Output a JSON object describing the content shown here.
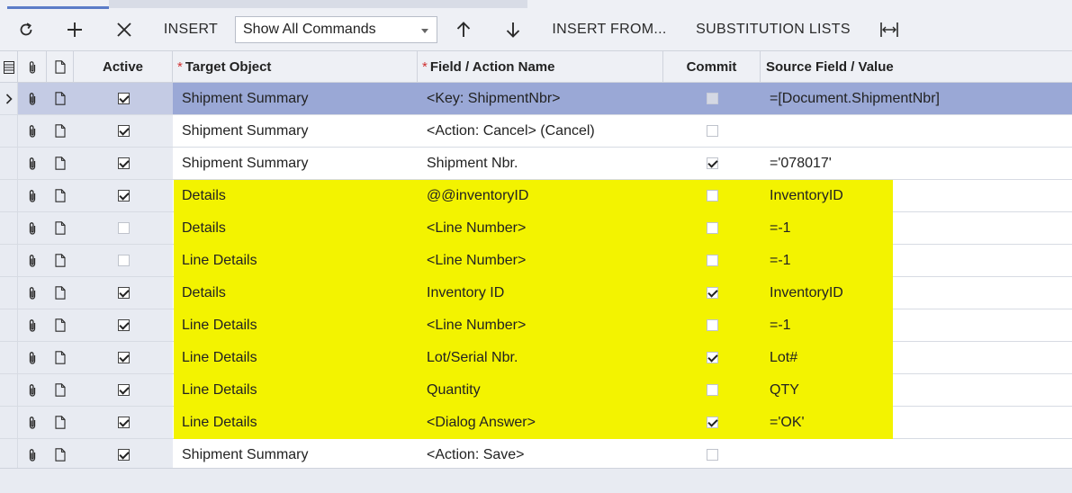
{
  "toolbar": {
    "insert_label": "INSERT",
    "command_filter": "Show All Commands",
    "insert_from_label": "INSERT FROM...",
    "substitution_lists_label": "SUBSTITUTION LISTS"
  },
  "columns": {
    "active": "Active",
    "target_object": "Target Object",
    "field_action_name": "Field / Action Name",
    "commit": "Commit",
    "source_field_value": "Source Field / Value",
    "required_marker": "*"
  },
  "colors": {
    "highlight": "#f3f300",
    "selected_row": "#9aa8d6"
  },
  "rows": [
    {
      "active": true,
      "target": "Shipment Summary",
      "field": "<Key: ShipmentNbr>",
      "commit": false,
      "source": "=[Document.ShipmentNbr]",
      "selected": true,
      "highlight": false
    },
    {
      "active": true,
      "target": "Shipment Summary",
      "field": "<Action: Cancel> (Cancel)",
      "commit": false,
      "source": "",
      "selected": false,
      "highlight": false
    },
    {
      "active": true,
      "target": "Shipment Summary",
      "field": "Shipment Nbr.",
      "commit": true,
      "source": "='078017'",
      "selected": false,
      "highlight": false
    },
    {
      "active": true,
      "target": "Details",
      "field": "@@inventoryID",
      "commit": false,
      "source": "InventoryID",
      "selected": false,
      "highlight": true
    },
    {
      "active": false,
      "target": "Details",
      "field": "<Line Number>",
      "commit": false,
      "source": "=-1",
      "selected": false,
      "highlight": true
    },
    {
      "active": false,
      "target": "Line Details",
      "field": "<Line Number>",
      "commit": false,
      "source": "=-1",
      "selected": false,
      "highlight": true
    },
    {
      "active": true,
      "target": "Details",
      "field": "Inventory ID",
      "commit": true,
      "source": "InventoryID",
      "selected": false,
      "highlight": true
    },
    {
      "active": true,
      "target": "Line Details",
      "field": "<Line Number>",
      "commit": false,
      "source": "=-1",
      "selected": false,
      "highlight": true
    },
    {
      "active": true,
      "target": "Line Details",
      "field": "Lot/Serial Nbr.",
      "commit": true,
      "source": "Lot#",
      "selected": false,
      "highlight": true
    },
    {
      "active": true,
      "target": "Line Details",
      "field": "Quantity",
      "commit": false,
      "source": "QTY",
      "selected": false,
      "highlight": true
    },
    {
      "active": true,
      "target": "Line Details",
      "field": "<Dialog Answer>",
      "commit": true,
      "source": "='OK'",
      "selected": false,
      "highlight": true
    },
    {
      "active": true,
      "target": "Shipment Summary",
      "field": "<Action: Save>",
      "commit": false,
      "source": "",
      "selected": false,
      "highlight": false
    }
  ]
}
